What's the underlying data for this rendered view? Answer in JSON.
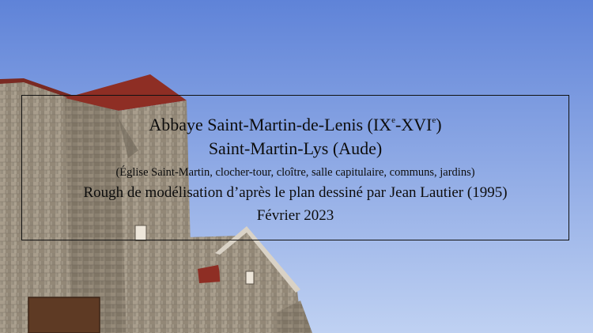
{
  "title_card": {
    "line1": {
      "prefix": "Abbaye Saint-Martin-de-Lenis (IX",
      "sup1": "e",
      "middle": "-XVI",
      "sup2": "e",
      "suffix": ")"
    },
    "line2": "Saint-Martin-Lys (Aude)",
    "line3": "(Église Saint-Martin, clocher-tour, cloître, salle capitulaire, communs, jardins)",
    "line4": "Rough de modélisation d’après le plan dessiné par Jean Lautier (1995)",
    "line5": "Février 2023"
  },
  "colors": {
    "sky_top": "#5f83d8",
    "sky_bottom": "#bfd1f2",
    "stone": "#9e9484",
    "stone_dark": "#847a6c",
    "roof": "#8e2e24",
    "door": "#5e3a24",
    "window": "#ede6da"
  }
}
